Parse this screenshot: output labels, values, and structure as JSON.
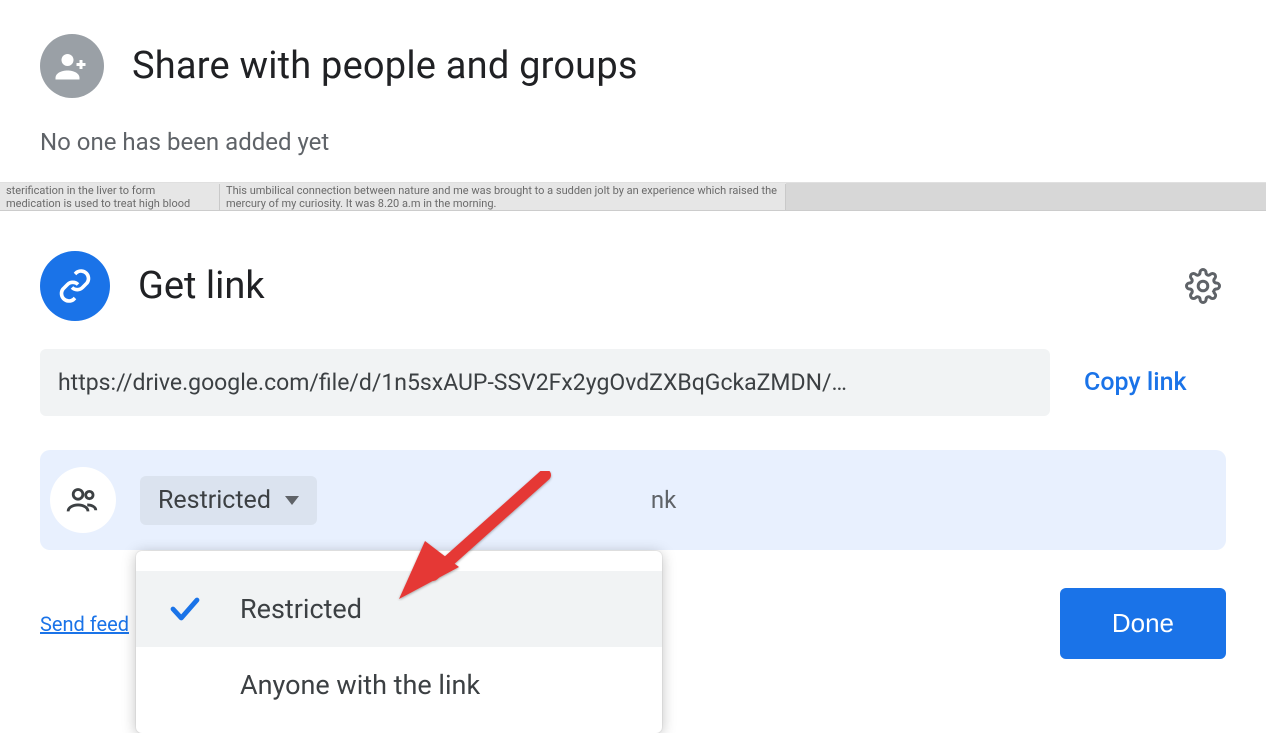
{
  "share": {
    "title": "Share with people and groups",
    "subtext": "No one has been added yet"
  },
  "doc_strip": {
    "col1a": "sterification in the liver to form",
    "col1b": "medication is used to treat high blood",
    "col2": "This umbilical connection between nature and me was brought to a sudden jolt by an experience which raised the mercury of my curiosity. It was 8.20 a.m in the morning."
  },
  "link": {
    "title": "Get link",
    "url": "https://drive.google.com/file/d/1n5sxAUP-SSV2Fx2ygOvdZXBqGckaZMDN/…",
    "copy_label": "Copy link",
    "access_trigger_label": "Restricted",
    "stray_text": "nk",
    "menu": {
      "option_restricted": "Restricted",
      "option_anyone": "Anyone with the link"
    },
    "feedback_label": "Send feed",
    "done_label": "Done"
  }
}
